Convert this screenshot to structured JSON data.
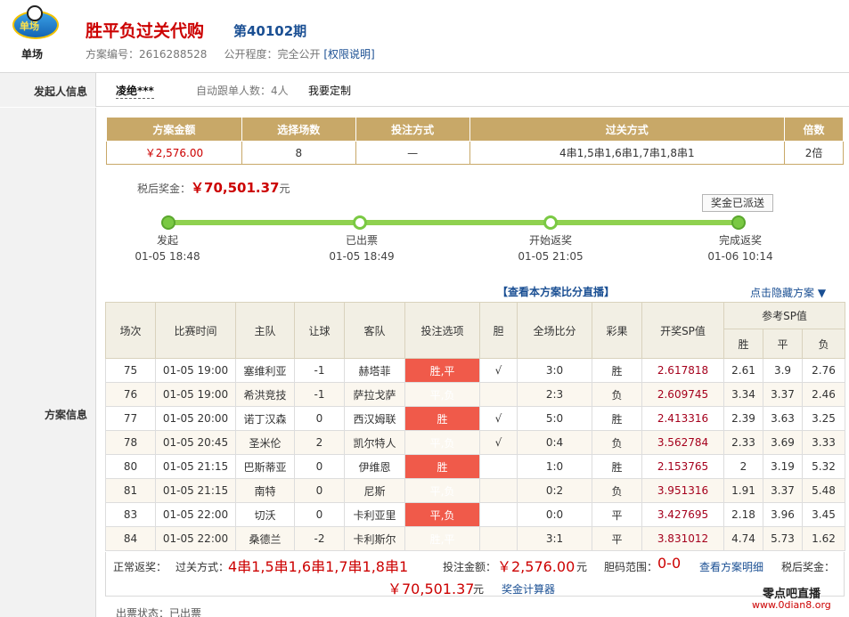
{
  "header": {
    "logo_text": "单场",
    "logo_badge": "单场",
    "title": "胜平负过关代购",
    "issue": "第40102期",
    "plan_no_label": "方案编号：",
    "plan_no": "2616288528",
    "public_label": "公开程度：",
    "public_value": "完全公开",
    "permission_link": "[权限说明]"
  },
  "initiator": {
    "section_label": "发起人信息",
    "name": "凌绝***",
    "follow_text": "自动跟单人数：4人",
    "custom_link": "我要定制"
  },
  "plan_section_label": "方案信息",
  "summary": {
    "headers": [
      "方案金额",
      "选择场数",
      "投注方式",
      "过关方式",
      "倍数"
    ],
    "values": [
      "￥2,576.00",
      "8",
      "—",
      "4串1,5串1,6串1,7串1,8串1",
      "2倍"
    ]
  },
  "post_tax": {
    "label": "税后奖金：",
    "amount": "￥70,501.37",
    "unit": "元"
  },
  "progress": {
    "badge": "奖金已派送",
    "stages": [
      {
        "name": "发起",
        "time": "01-05 18:48"
      },
      {
        "name": "已出票",
        "time": "01-05 18:49"
      },
      {
        "name": "开始返奖",
        "time": "01-05 21:05"
      },
      {
        "name": "完成返奖",
        "time": "01-06 10:14"
      }
    ]
  },
  "links": {
    "score_live": "【查看本方案比分直播】",
    "hide_plan": "点击隐藏方案 ▼"
  },
  "table": {
    "headers": [
      "场次",
      "比赛时间",
      "主队",
      "让球",
      "客队",
      "投注选项",
      "胆",
      "全场比分",
      "彩果",
      "开奖SP值"
    ],
    "ref_sp": "参考SP值",
    "ref_sub": [
      "胜",
      "平",
      "负"
    ],
    "rows": [
      [
        "75",
        "01-05 19:00",
        "塞维利亚",
        "-1",
        "赫塔菲",
        "胜,平",
        "√",
        "3:0",
        "胜",
        "2.617818",
        "2.61",
        "3.9",
        "2.76"
      ],
      [
        "76",
        "01-05 19:00",
        "希洪竞技",
        "-1",
        "萨拉戈萨",
        "平,负",
        "",
        "2:3",
        "负",
        "2.609745",
        "3.34",
        "3.37",
        "2.46"
      ],
      [
        "77",
        "01-05 20:00",
        "诺丁汉森",
        "0",
        "西汉姆联",
        "胜",
        "√",
        "5:0",
        "胜",
        "2.413316",
        "2.39",
        "3.63",
        "3.25"
      ],
      [
        "78",
        "01-05 20:45",
        "圣米伦",
        "2",
        "凯尔特人",
        "平,负",
        "√",
        "0:4",
        "负",
        "3.562784",
        "2.33",
        "3.69",
        "3.33"
      ],
      [
        "80",
        "01-05 21:15",
        "巴斯蒂亚",
        "0",
        "伊维恩",
        "胜",
        "",
        "1:0",
        "胜",
        "2.153765",
        "2",
        "3.19",
        "5.32"
      ],
      [
        "81",
        "01-05 21:15",
        "南特",
        "0",
        "尼斯",
        "平,负",
        "",
        "0:2",
        "负",
        "3.951316",
        "1.91",
        "3.37",
        "5.48"
      ],
      [
        "83",
        "01-05 22:00",
        "切沃",
        "0",
        "卡利亚里",
        "平,负",
        "",
        "0:0",
        "平",
        "3.427695",
        "2.18",
        "3.96",
        "3.45"
      ],
      [
        "84",
        "01-05 22:00",
        "桑德兰",
        "-2",
        "卡利斯尔",
        "胜,平",
        "",
        "3:1",
        "平",
        "3.831012",
        "4.74",
        "5.73",
        "1.62"
      ]
    ]
  },
  "footer": {
    "normal_label": "正常返奖：",
    "pass_label": "过关方式：",
    "pass_value": "4串1,5串1,6串1,7串1,8串1",
    "bet_label": "投注金额：",
    "bet_value": "￥2,576.00",
    "bet_unit": "元",
    "banker_label": "胆码范围：",
    "banker_value": "0-0",
    "detail_link": "查看方案明细",
    "posttax_label": "税后奖金：",
    "posttax_value": "￥70,501.37",
    "posttax_unit": "元",
    "calc_link": "奖金计算器"
  },
  "status": "出票状态：已出票",
  "watermark": {
    "title": "零点吧直播",
    "url": "www.0dian8.org"
  }
}
